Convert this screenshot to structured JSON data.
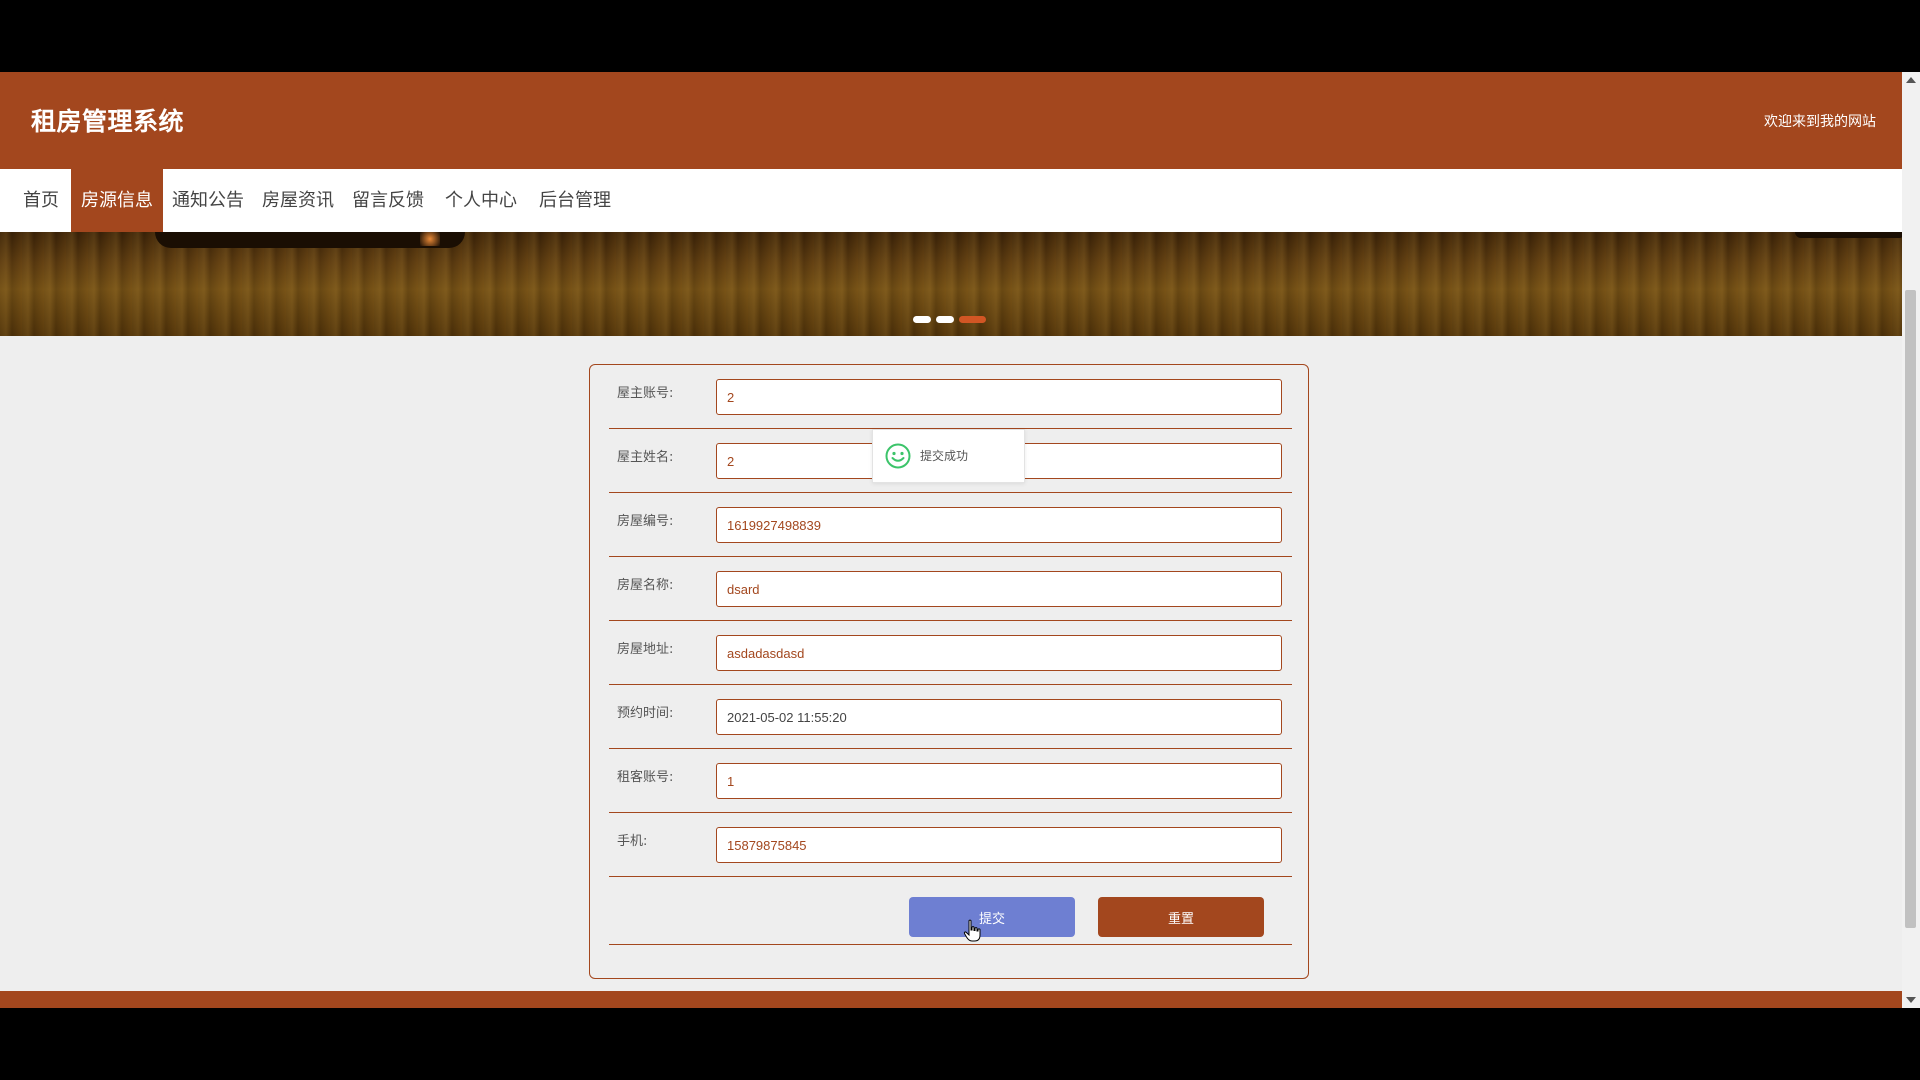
{
  "header": {
    "title": "租房管理系统",
    "welcome": "欢迎来到我的网站"
  },
  "nav": {
    "items": [
      {
        "label": "首页"
      },
      {
        "label": "房源信息",
        "active": true
      },
      {
        "label": "通知公告"
      },
      {
        "label": "房屋资讯"
      },
      {
        "label": "留言反馈"
      },
      {
        "label": "个人中心"
      },
      {
        "label": "后台管理"
      }
    ]
  },
  "carousel": {
    "slide_count": 3,
    "active_index": 2
  },
  "form": {
    "fields": [
      {
        "label": "屋主账号:",
        "value": "2"
      },
      {
        "label": "屋主姓名:",
        "value": "2"
      },
      {
        "label": "房屋编号:",
        "value": "1619927498839"
      },
      {
        "label": "房屋名称:",
        "value": "dsard"
      },
      {
        "label": "房屋地址:",
        "value": "asdadasdasd"
      },
      {
        "label": "预约时间:",
        "value": "2021-05-02 11:55:20"
      },
      {
        "label": "租客账号:",
        "value": "1"
      },
      {
        "label": "手机:",
        "value": "15879875845"
      }
    ],
    "submit_label": "提交",
    "reset_label": "重置"
  },
  "toast": {
    "message": "提交成功",
    "icon": "smile-icon"
  },
  "colors": {
    "brand": "#a3471e",
    "submit": "#6e7fd2",
    "toast_icon": "#3cc46a"
  }
}
